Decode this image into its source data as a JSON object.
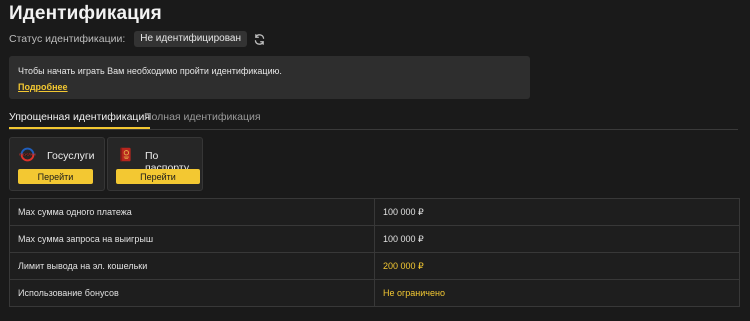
{
  "page": {
    "title": "Идентификация"
  },
  "status": {
    "label": "Статус идентификации:",
    "value": "Не идентифицирован"
  },
  "notice": {
    "text": "Чтобы начать играть Вам необходимо пройти идентификацию.",
    "link": "Подробнее"
  },
  "tabs": [
    {
      "label": "Упрощенная идентификация",
      "active": true
    },
    {
      "label": "Полная идентификация",
      "active": false
    }
  ],
  "methods": [
    {
      "title": "Госуслуги",
      "button": "Перейти",
      "icon": "gosuslugi-logo-icon"
    },
    {
      "title": "По паспорту",
      "button": "Перейти",
      "icon": "passport-icon"
    }
  ],
  "limits": [
    {
      "label": "Max сумма одного платежа",
      "value": "100 000 ₽",
      "highlight": false
    },
    {
      "label": "Max сумма запроса на выигрыш",
      "value": "100 000 ₽",
      "highlight": false
    },
    {
      "label": "Лимит вывода на эл. кошельки",
      "value": "200 000 ₽",
      "highlight": true
    },
    {
      "label": "Использование бонусов",
      "value": "Не ограничено",
      "highlight": true
    }
  ],
  "colors": {
    "accent": "#f3c832",
    "background": "#1a1a1a",
    "panel": "#2e2e2e"
  }
}
